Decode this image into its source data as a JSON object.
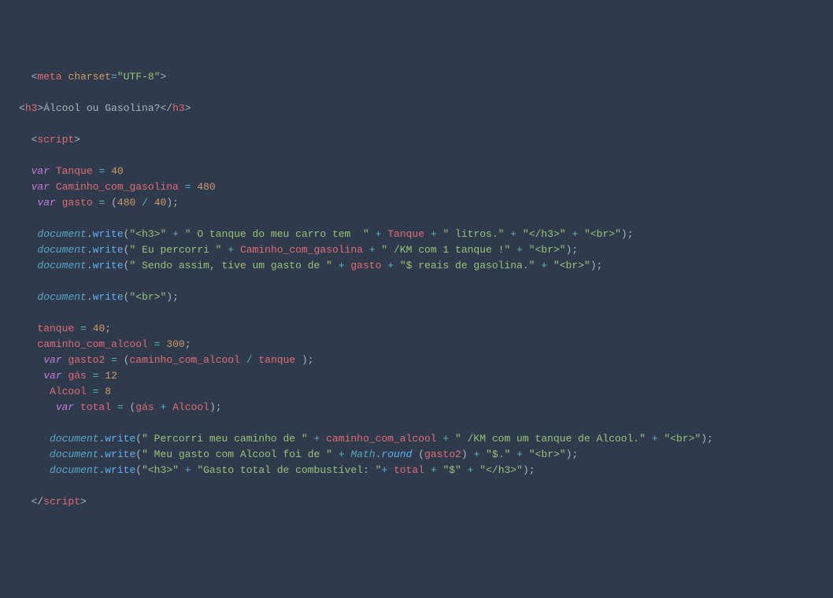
{
  "line1": {
    "t1": "meta",
    "a1": "charset",
    "s1": "\"UTF-8\""
  },
  "line3": {
    "t1": "h3",
    "tx": "Álcool ou Gasolina?",
    "t2": "h3"
  },
  "line5": {
    "t1": "script"
  },
  "line7": {
    "kw": "var",
    "v": "Tanque",
    "n": "40"
  },
  "line8": {
    "kw": "var",
    "v": "Caminho_com_gasolina",
    "n": "480"
  },
  "line9": {
    "kw": "var",
    "v": "gasto",
    "n1": "480",
    "n2": "40"
  },
  "line11": {
    "obj": "document",
    "fn": "write",
    "s1": "\"<h3>\"",
    "s2": "\" O tanque do meu carro tem  \"",
    "v": "Tanque",
    "s3": "\" litros.\"",
    "s4": "\"</h3>\"",
    "s5": "\"<br>\""
  },
  "line12": {
    "obj": "document",
    "fn": "write",
    "s1": "\" Eu percorri \"",
    "v": "Caminho_com_gasolina",
    "s2": "\" /KM com 1 tanque !\"",
    "s3": "\"<br>\""
  },
  "line13": {
    "obj": "document",
    "fn": "write",
    "s1": "\" Sendo assim, tive um gasto de \"",
    "v": "gasto",
    "s2": "\"$ reais de gasolina.\"",
    "s3": "\"<br>\""
  },
  "line15": {
    "obj": "document",
    "fn": "write",
    "s1": "\"<br>\""
  },
  "line17": {
    "v": "tanque",
    "n": "40"
  },
  "line18": {
    "v": "caminho_com_alcool",
    "n": "300"
  },
  "line19": {
    "kw": "var",
    "v": "gasto2",
    "v1": "caminho_com_alcool",
    "v2": "tanque"
  },
  "line20": {
    "kw": "var",
    "v": "gás",
    "n": "12"
  },
  "line21": {
    "v": "Alcool",
    "n": "8"
  },
  "line22": {
    "kw": "var",
    "v": "total",
    "v1": "gás",
    "v2": "Alcool"
  },
  "line24": {
    "obj": "document",
    "fn": "write",
    "s1": "\" Percorri meu caminho de \"",
    "v": "caminho_com_alcool",
    "s2": "\" /KM com um tanque de Alcool.\"",
    "s3": "\"<br>\""
  },
  "line25": {
    "obj": "document",
    "fn": "write",
    "s1": "\" Meu gasto com Alcool foi de \"",
    "m": "Math",
    "fr": "round",
    "v": "gasto2",
    "s2": "\"$.\"",
    "s3": "\"<br>\""
  },
  "line26": {
    "obj": "document",
    "fn": "write",
    "s1": "\"<h3>\"",
    "s2": "\"Gasto total de combustível: \"",
    "v": "total",
    "s3": "\"$\"",
    "s4": "\"</h3>\""
  },
  "line28": {
    "t1": "script"
  }
}
